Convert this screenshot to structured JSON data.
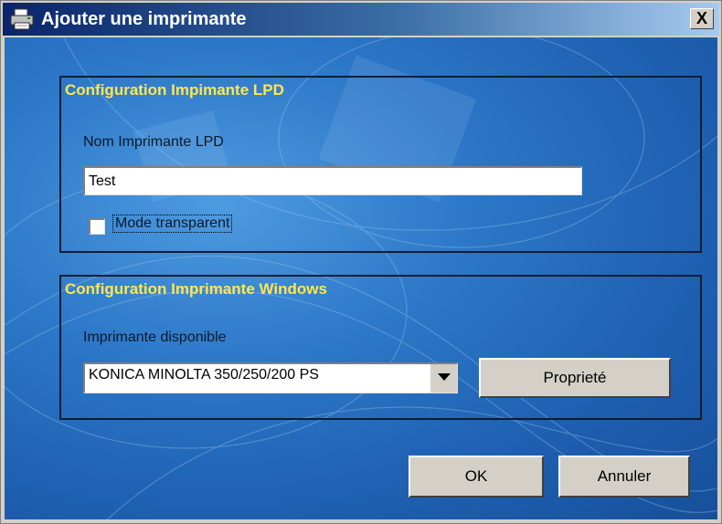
{
  "window": {
    "title": "Ajouter une imprimante",
    "close_label": "X"
  },
  "lpd_group": {
    "title": "Configuration Impimante LPD",
    "name_label": "Nom Imprimante LPD",
    "name_value": "Test",
    "transparent_mode_label": "Mode transparent",
    "transparent_mode_checked": false
  },
  "windows_group": {
    "title": "Configuration Imprimante Windows",
    "printer_label": "Imprimante disponible",
    "printer_selected": "KONICA MINOLTA 350/250/200 PS",
    "properties_button": "Proprieté"
  },
  "footer": {
    "ok_button": "OK",
    "cancel_button": "Annuler"
  },
  "colors": {
    "group_title": "#ffe84a",
    "background_blue": "#2d78c8",
    "titlebar": "#0a246a"
  }
}
